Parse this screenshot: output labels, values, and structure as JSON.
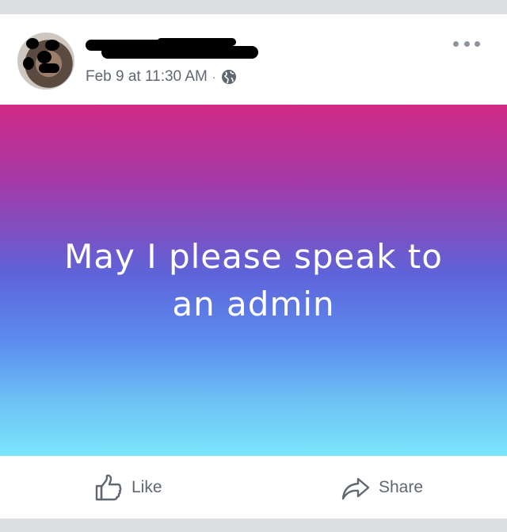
{
  "post": {
    "timestamp": "Feb 9 at 11:30 AM",
    "separator": "·",
    "privacy_icon": "globe-icon",
    "more_icon": "more-dots-icon",
    "text": "May I please speak to an admin",
    "background_gradient": [
      "#d12a86",
      "#a43aa7",
      "#5e63d8",
      "#5c8ef0",
      "#6ec3f4",
      "#7ae6fb"
    ]
  },
  "actions": {
    "like_label": "Like",
    "like_icon": "thumbs-up-icon",
    "share_label": "Share",
    "share_icon": "share-arrow-icon"
  },
  "colors": {
    "meta_text": "#616770",
    "action_text": "#606770",
    "page_background": "#dddfe3"
  }
}
